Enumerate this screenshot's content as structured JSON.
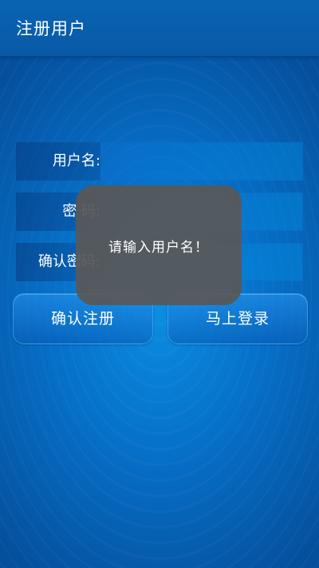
{
  "appbar": {
    "title": "注册用户"
  },
  "form": {
    "username_label": "用户名:",
    "password_label": "密 码:",
    "confirm_label": "确认密码:",
    "username_value": "",
    "password_value": "",
    "confirm_value": ""
  },
  "buttons": {
    "register_label": "确认注册",
    "login_label": "马上登录"
  },
  "toast": {
    "message": "请输入用户名！"
  },
  "colors": {
    "background": "#0670c8",
    "appbar": "#085aa6",
    "toast": "#585858"
  }
}
